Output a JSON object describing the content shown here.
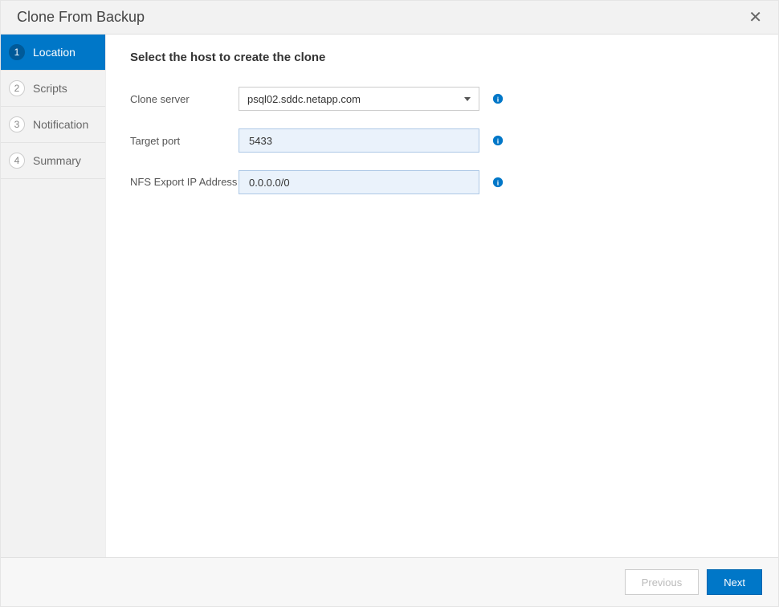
{
  "header": {
    "title": "Clone From Backup"
  },
  "sidebar": {
    "steps": [
      {
        "num": "1",
        "label": "Location"
      },
      {
        "num": "2",
        "label": "Scripts"
      },
      {
        "num": "3",
        "label": "Notification"
      },
      {
        "num": "4",
        "label": "Summary"
      }
    ]
  },
  "content": {
    "heading": "Select the host to create the clone",
    "fields": {
      "clone_server": {
        "label": "Clone server",
        "value": "psql02.sddc.netapp.com"
      },
      "target_port": {
        "label": "Target port",
        "value": "5433"
      },
      "nfs_export_ip": {
        "label": "NFS Export IP Address",
        "value": "0.0.0.0/0"
      }
    }
  },
  "footer": {
    "previous": "Previous",
    "next": "Next"
  }
}
